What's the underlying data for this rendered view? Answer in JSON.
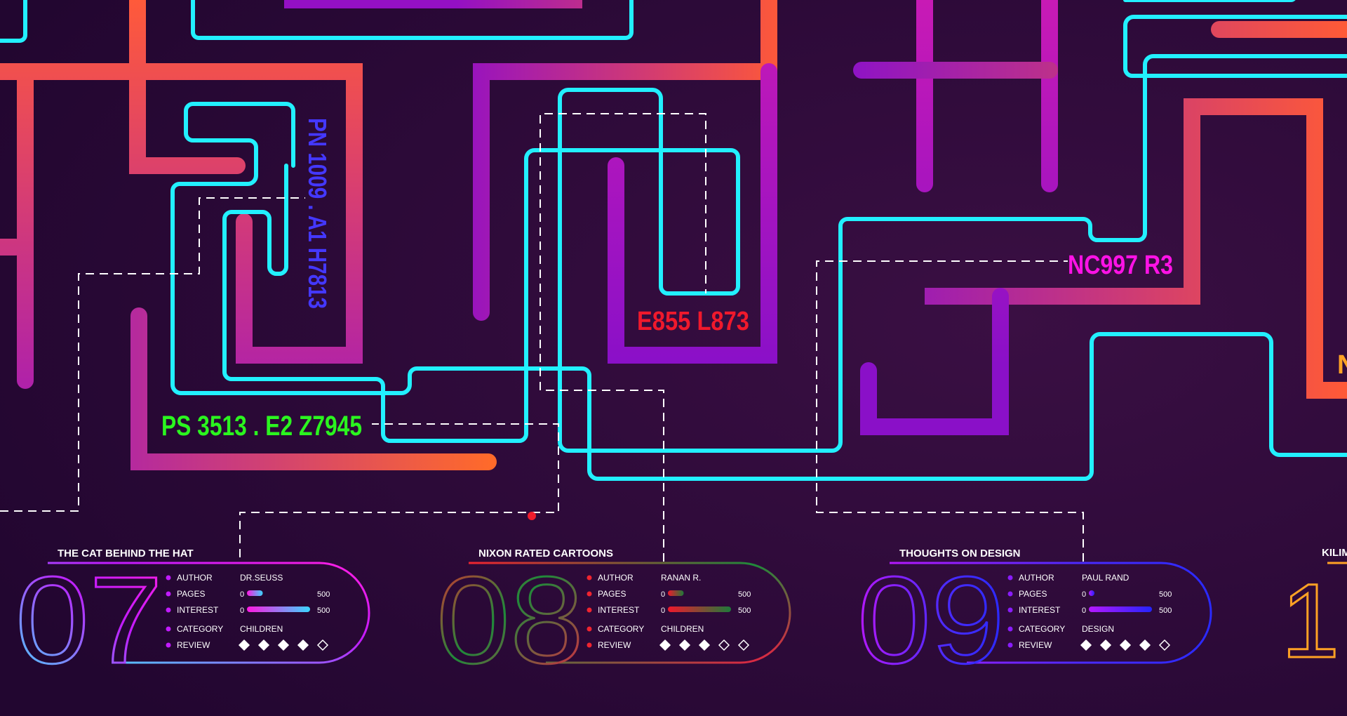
{
  "colors": {
    "background": "#2a0836",
    "cyan": "#22f0ff",
    "dash": "#ffffff",
    "green": "#2bf51f",
    "red": "#f0192c",
    "magenta": "#ff12e6",
    "blue": "#4438ff",
    "orange": "#ffa224"
  },
  "call_numbers": {
    "pn": "PN 1009 . A1 H7813",
    "ps": "PS 3513 . E2 Z7945",
    "e": "E855 L873",
    "nc": "NC997 R3"
  },
  "fields": {
    "author": "AUTHOR",
    "pages": "PAGES",
    "interest": "INTEREST",
    "category": "CATEGORY",
    "review": "REVIEW",
    "min": "0",
    "max": "500"
  },
  "cards": [
    {
      "number": "07",
      "title": "THE CAT BEHIND THE HAT",
      "author": "DR.SEUSS",
      "category": "CHILDREN",
      "pages_fraction": 0.25,
      "interest_fraction": 1.0,
      "rating": 4,
      "rating_max": 5
    },
    {
      "number": "08",
      "title": "NIXON RATED CARTOONS",
      "author": "RANAN R.",
      "category": "CHILDREN",
      "pages_fraction": 0.25,
      "interest_fraction": 1.0,
      "rating": 3,
      "rating_max": 5
    },
    {
      "number": "09",
      "title": "THOUGHTS ON DESIGN",
      "author": "PAUL RAND",
      "category": "DESIGN",
      "pages_fraction": 0.08,
      "interest_fraction": 1.0,
      "rating": 4,
      "rating_max": 5
    }
  ],
  "partial_card": {
    "title": "KILIM",
    "number": "1"
  }
}
